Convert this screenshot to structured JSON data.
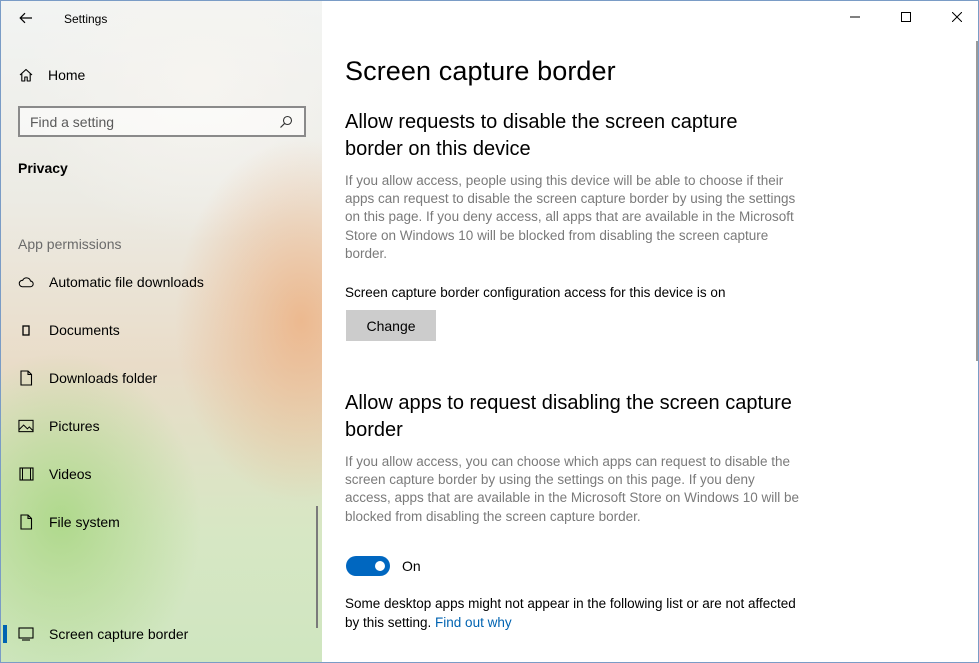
{
  "window": {
    "title": "Settings"
  },
  "sidebar": {
    "home_label": "Home",
    "search_placeholder": "Find a setting",
    "section": "Privacy",
    "group_label": "App permissions",
    "items": [
      {
        "label": "Automatic file downloads",
        "icon": "cloud-icon"
      },
      {
        "label": "Documents",
        "icon": "document-icon"
      },
      {
        "label": "Downloads folder",
        "icon": "file-icon"
      },
      {
        "label": "Pictures",
        "icon": "picture-icon"
      },
      {
        "label": "Videos",
        "icon": "video-icon"
      },
      {
        "label": "File system",
        "icon": "file-icon"
      },
      {
        "label": "Screen capture border",
        "icon": "screen-capture-icon",
        "selected": true
      }
    ]
  },
  "main": {
    "page_title": "Screen capture border",
    "section1": {
      "heading": "Allow requests to disable the screen capture border on this device",
      "description": "If you allow access, people using this device will be able to choose if their apps can request to disable the screen capture border by using the settings on this page. If you deny access, all apps that are available in the Microsoft Store on Windows 10 will be blocked from disabling the screen capture border.",
      "status": "Screen capture border configuration access for this device is on",
      "button_label": "Change"
    },
    "section2": {
      "heading": "Allow apps to request disabling the screen capture border",
      "description": "If you allow access, you can choose which apps can request to disable the screen capture border by using the settings on this page. If you deny access, apps that are available in the Microsoft Store on Windows 10 will be blocked from disabling the screen capture border.",
      "toggle_state": "On",
      "note_text": "Some desktop apps might not appear in the following list or are not affected by this setting. ",
      "note_link": "Find out why"
    }
  },
  "colors": {
    "accent": "#0067c0",
    "link": "#0063b1",
    "button_bg": "#cccccc",
    "muted_text": "#7a7a7a"
  }
}
